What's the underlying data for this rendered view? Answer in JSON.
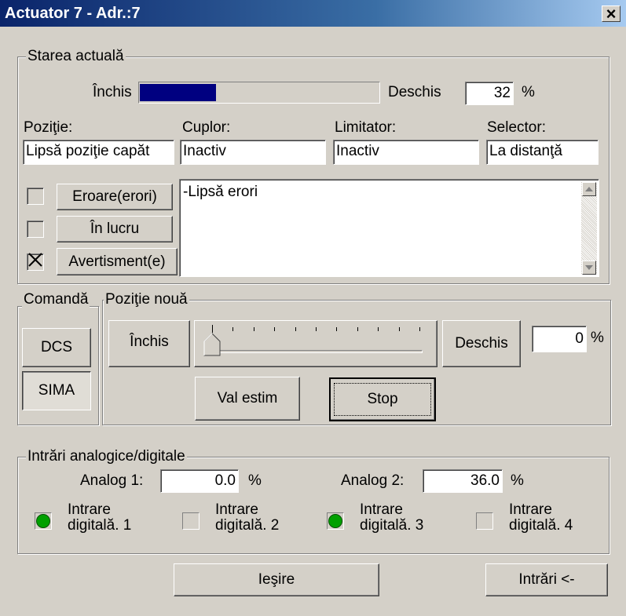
{
  "window": {
    "title": "Actuator 7 - Adr.:7",
    "close_glyph": "×"
  },
  "state": {
    "legend": "Starea actuală",
    "closed_label": "Închis",
    "open_label": "Deschis",
    "position_value": "32",
    "percent": "%",
    "progress_fraction": 0.32,
    "fields": [
      {
        "label": "Poziţie:",
        "value": "Lipsă poziţie capăt"
      },
      {
        "label": "Cuplor:",
        "value": "Inactiv"
      },
      {
        "label": "Limitator:",
        "value": "Inactiv"
      },
      {
        "label": "Selector:",
        "value": "La distanţă"
      }
    ],
    "indicators": [
      {
        "label": "Eroare(erori)",
        "checked": false
      },
      {
        "label": "În lucru",
        "checked": false
      },
      {
        "label": "Avertisment(e)",
        "checked": true
      }
    ],
    "messages": "-Lipsă erori"
  },
  "command": {
    "legend": "Comandă",
    "dcs_label": "DCS",
    "sima_label": "SIMA"
  },
  "new_position": {
    "legend": "Poziţie nouă",
    "closed_button": "Închis",
    "open_button": "Deschis",
    "value": "0",
    "percent": "%",
    "slider_fraction": 0.0,
    "estimate_button": "Val estim",
    "stop_button": "Stop"
  },
  "io": {
    "legend": "Intrări analogice/digitale",
    "analog1_label": "Analog 1:",
    "analog1_value": "0.0",
    "analog2_label": "Analog 2:",
    "analog2_value": "36.0",
    "percent": "%",
    "digital": [
      {
        "line1": "Intrare",
        "line2": "digitală. 1",
        "on": true
      },
      {
        "line1": "Intrare",
        "line2": "digitală. 2",
        "on": false
      },
      {
        "line1": "Intrare",
        "line2": "digitală. 3",
        "on": true
      },
      {
        "line1": "Intrare",
        "line2": "digitală. 4",
        "on": false
      }
    ],
    "led_on_color": "#00a000"
  },
  "footer": {
    "exit_button": "Ieşire",
    "inputs_button": "Intrări <-"
  }
}
